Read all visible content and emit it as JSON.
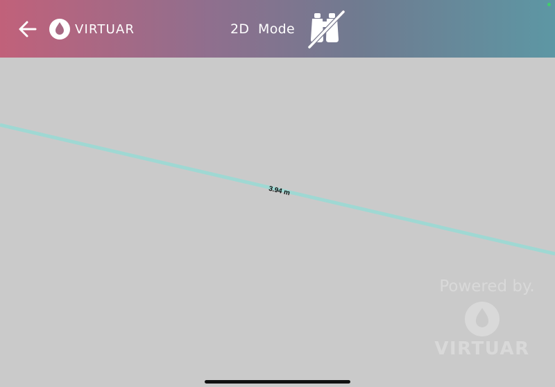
{
  "header": {
    "brand": "VIRTUAR",
    "mode_title": "2D  Mode",
    "back_icon": "arrow-left-icon",
    "toggle_icon": "binoculars-off-icon",
    "gradient_colors": [
      "#c1617a",
      "#5d97a4"
    ]
  },
  "measurement": {
    "label": "3.94 m",
    "line_color": "#9fd8d3"
  },
  "watermark": {
    "powered_label": "Powered by.",
    "brand": "VIRTUAR"
  },
  "colors": {
    "background": "#cacaca",
    "status_dot": "#3fd06a"
  }
}
